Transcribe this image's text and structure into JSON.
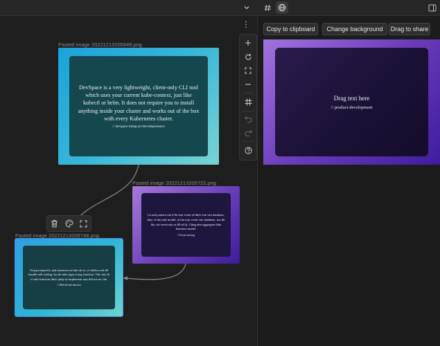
{
  "topbar": {
    "icons": [
      "chevron-down-icon",
      "hash-icon",
      "globe-icon",
      "sidebar-toggle-icon"
    ]
  },
  "canvas": {
    "nodes": [
      {
        "title": "Pasted image 20221213205849.png",
        "main": "DevSpace is a very lightweight, client-only CLI tool which uses your current kube-context, just like kubectl or helm. It does not require you to install anything inside your cluster and works out of the box with every Kubernetes cluster.",
        "sub": "// devspace tương tự như telepresence"
      },
      {
        "title": "Pasted image 20221213205722.png",
        "main": "Là một pattern mà ở đó mọi event sẽ được lưu vào database, thay vì lưu một model, ta lưu mọi event vào database, sau đó lấy các event này ra để xử lý. Cũng như aggregate thân business model.",
        "sub": "// Event sourcing"
      },
      {
        "title": "Pasted image 20221213205748.png",
        "main": "Trong trueprofit, một function trở nên rất to, có nhiều code để handle mỗi trường, họ tấn nằm ngay trong function. Việc này là vì mỗi function được phép tự implement mọi thứ mà nó cần.",
        "sub": "// Thiết kế một function"
      }
    ],
    "node_toolbar": [
      "trash-icon",
      "palette-icon",
      "expand-icon"
    ],
    "right_tools": [
      "plus-icon",
      "reset-icon",
      "fit-icon",
      "minus-icon",
      "grid-icon",
      "undo-icon",
      "redo-icon",
      "help-icon"
    ]
  },
  "panel": {
    "copy_label": "Copy to clipboard",
    "bg_label": "Change background",
    "drag_label": "Drag to share",
    "preview_main": "Drag text here",
    "preview_sub": "// product-development"
  }
}
